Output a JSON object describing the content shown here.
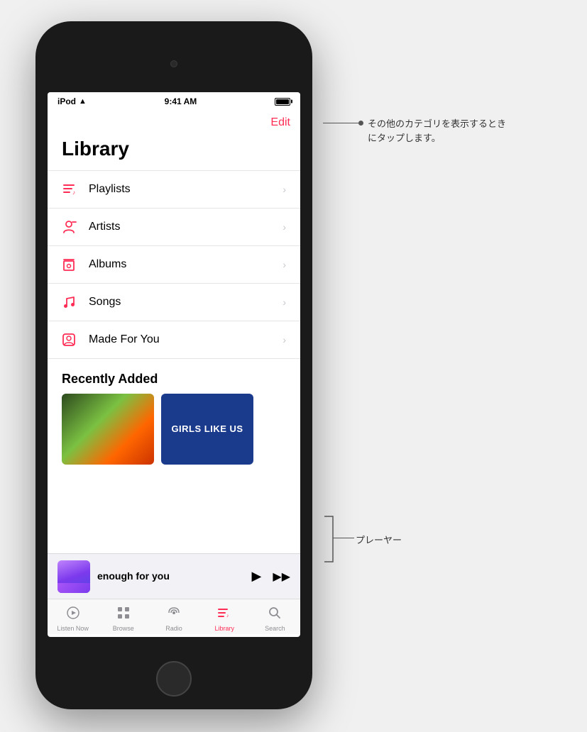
{
  "device": {
    "status_bar": {
      "carrier": "iPod",
      "time": "9:41 AM",
      "battery_full": true
    }
  },
  "screen": {
    "edit_button": "Edit",
    "library_title": "Library",
    "menu_items": [
      {
        "id": "playlists",
        "label": "Playlists",
        "icon": "♫"
      },
      {
        "id": "artists",
        "label": "Artists",
        "icon": "🎤"
      },
      {
        "id": "albums",
        "label": "Albums",
        "icon": "💿"
      },
      {
        "id": "songs",
        "label": "Songs",
        "icon": "♪"
      },
      {
        "id": "made-for-you",
        "label": "Made For You",
        "icon": "🖼"
      }
    ],
    "recently_added_title": "Recently Added",
    "album_2_text": "GIRLS LIKE US",
    "mini_player": {
      "song_title": "enough for you",
      "play_icon": "▶",
      "forward_icon": "⏩"
    },
    "tab_bar": [
      {
        "id": "listen-now",
        "label": "Listen Now",
        "icon": "▶",
        "active": false
      },
      {
        "id": "browse",
        "label": "Browse",
        "icon": "⊞",
        "active": false
      },
      {
        "id": "radio",
        "label": "Radio",
        "icon": "📡",
        "active": false
      },
      {
        "id": "library",
        "label": "Library",
        "icon": "♫",
        "active": true
      },
      {
        "id": "search",
        "label": "Search",
        "icon": "🔍",
        "active": false
      }
    ]
  },
  "callouts": {
    "edit": "その他のカテゴリを表示するときにタップします。",
    "player": "プレーヤー"
  }
}
